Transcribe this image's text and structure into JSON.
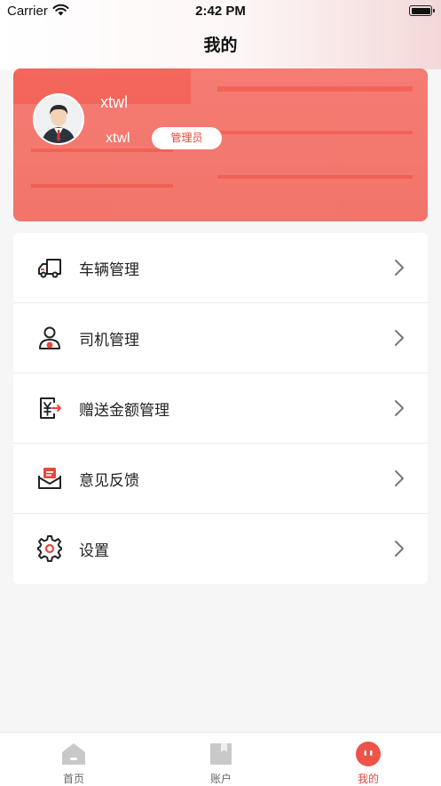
{
  "status_bar": {
    "carrier": "Carrier",
    "time": "2:42 PM"
  },
  "header": {
    "title": "我的"
  },
  "profile": {
    "name": "xtwl",
    "account": "xtwl",
    "role": "管理员"
  },
  "menu": [
    {
      "label": "车辆管理",
      "icon": "truck-icon"
    },
    {
      "label": "司机管理",
      "icon": "driver-icon"
    },
    {
      "label": "赠送金额管理",
      "icon": "yuan-transfer-icon"
    },
    {
      "label": "意见反馈",
      "icon": "feedback-mail-icon"
    },
    {
      "label": "设置",
      "icon": "gear-icon"
    }
  ],
  "tabbar": [
    {
      "label": "首页",
      "icon": "home-icon",
      "active": false
    },
    {
      "label": "账户",
      "icon": "account-book-icon",
      "active": false
    },
    {
      "label": "我的",
      "icon": "me-icon",
      "active": true
    }
  ],
  "colors": {
    "accent": "#e9473d",
    "card": "#f4675d",
    "background": "#f6f6f6"
  }
}
